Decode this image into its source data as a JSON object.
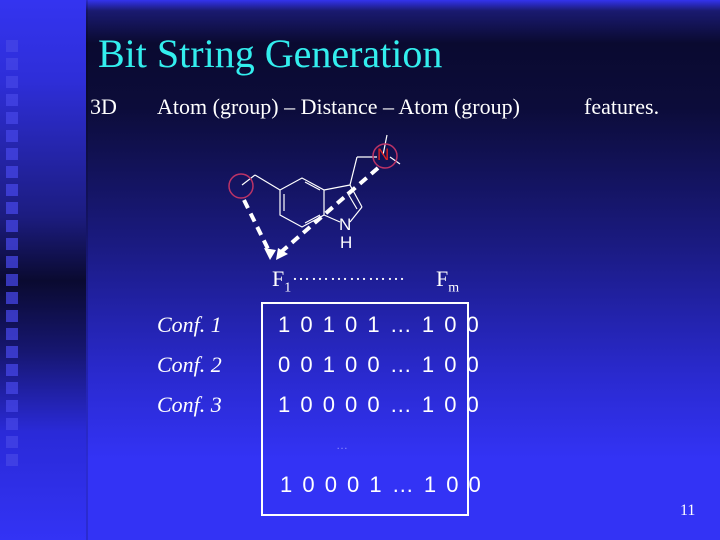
{
  "slide": {
    "title": "Bit String Generation",
    "subtitle_prefix": "3D",
    "subtitle_main": "Atom (group) – Distance – Atom (group)",
    "subtitle_suffix": "features.",
    "page_number": "11",
    "colors": {
      "title": "#33eeee",
      "text": "#ffffff",
      "highlight_atom": "#dd2222",
      "highlight_circle": "#bb3366"
    }
  },
  "molecule": {
    "atom_labels": [
      {
        "id": "n-amine",
        "label": "N"
      },
      {
        "id": "n-indole",
        "label": "N"
      },
      {
        "id": "h-indole",
        "label": "H"
      }
    ],
    "feature_first": {
      "base": "F",
      "index": "1"
    },
    "feature_dots": "………………",
    "feature_last": {
      "base": "F",
      "index": "m"
    }
  },
  "conformations": [
    {
      "label": "Conf. 1",
      "bits": "1 0 1 0 1 … 1 0 0"
    },
    {
      "label": "Conf. 2",
      "bits": "0 0 1 0 0 … 1 0 0"
    },
    {
      "label": "Conf. 3",
      "bits": "1 0 0 0 0 … 1 0 0"
    }
  ],
  "ellipsis": "…",
  "combined_bits": "1 0 0 0 1 … 1 0 0"
}
